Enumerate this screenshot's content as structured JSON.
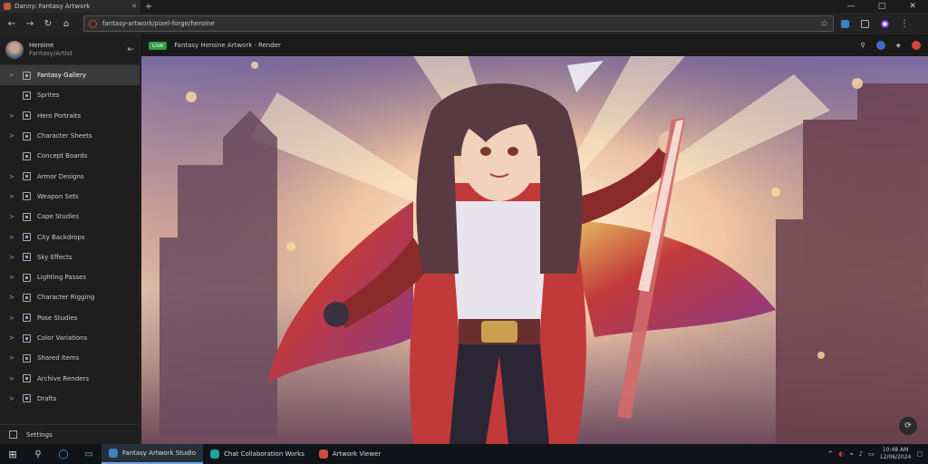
{
  "browser": {
    "tab_title": "Danny: Fantasy Artwork",
    "address": "fantasy-artwork/pixel-forge/heroine",
    "window_controls": [
      "—",
      "□",
      "✕"
    ]
  },
  "sidebar": {
    "profile_name": "Heroine",
    "profile_sub": "Fantasy/Artist",
    "items": [
      {
        "label": "Fantasy Gallery",
        "active": true,
        "chev": true
      },
      {
        "label": "Sprites",
        "active": false,
        "chev": false
      },
      {
        "label": "Hero Portraits",
        "active": false,
        "chev": true
      },
      {
        "label": "Character Sheets",
        "active": false,
        "chev": true
      },
      {
        "label": "Concept Boards",
        "active": false,
        "chev": false
      },
      {
        "label": "Armor Designs",
        "active": false,
        "chev": true
      },
      {
        "label": "Weapon Sets",
        "active": false,
        "chev": true
      },
      {
        "label": "Cape Studies",
        "active": false,
        "chev": true
      },
      {
        "label": "City Backdrops",
        "active": false,
        "chev": true
      },
      {
        "label": "Sky Effects",
        "active": false,
        "chev": true
      },
      {
        "label": "Lighting Passes",
        "active": false,
        "chev": true
      },
      {
        "label": "Character Rigging",
        "active": false,
        "chev": true
      },
      {
        "label": "Pose Studies",
        "active": false,
        "chev": true
      },
      {
        "label": "Color Variations",
        "active": false,
        "chev": true
      },
      {
        "label": "Shared Items",
        "active": false,
        "chev": true
      },
      {
        "label": "Archive Renders",
        "active": false,
        "chev": true
      },
      {
        "label": "Drafts",
        "active": false,
        "chev": true
      }
    ],
    "footer_label": "Settings"
  },
  "content": {
    "badge": "Live",
    "toolbar_title": "Fantasy Heroine Artwork · Render"
  },
  "taskbar": {
    "apps": [
      {
        "label": "Fantasy Artwork Studio",
        "color": "#3b82c4",
        "active": true
      },
      {
        "label": "Chat Collaboration Works",
        "color": "#1fa39a",
        "active": false
      },
      {
        "label": "Artwork Viewer",
        "color": "#d04a3c",
        "active": false
      }
    ],
    "time": "10:48 AM",
    "date": "12/06/2024"
  }
}
